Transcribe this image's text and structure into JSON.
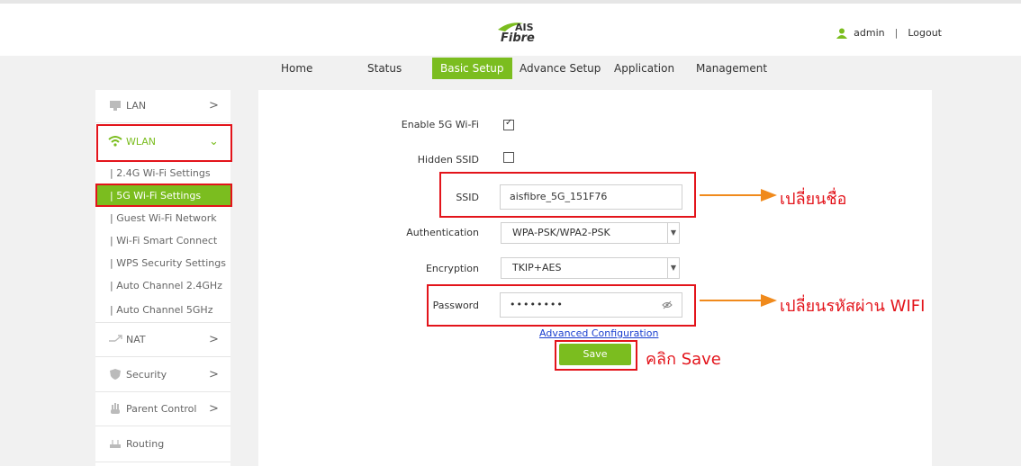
{
  "header": {
    "logo_top": "AIS",
    "logo_bottom": "Fibre",
    "user_name": "admin",
    "separator": "|",
    "logout_label": "Logout"
  },
  "nav": {
    "items": [
      {
        "label": "Home"
      },
      {
        "label": "Status"
      },
      {
        "label": "Basic Setup",
        "active": true
      },
      {
        "label": "Advance Setup"
      },
      {
        "label": "Application"
      },
      {
        "label": "Management"
      }
    ]
  },
  "sidebar": {
    "lan_label": "LAN",
    "wlan_label": "WLAN",
    "wlan_sub": [
      "| 2.4G Wi-Fi Settings",
      "| 5G Wi-Fi Settings",
      "| Guest Wi-Fi Network",
      "| Wi-Fi Smart Connect",
      "| WPS Security Settings",
      "| Auto Channel 2.4GHz",
      "| Auto Channel 5GHz"
    ],
    "nat_label": "NAT",
    "security_label": "Security",
    "parent_label": "Parent Control",
    "routing_label": "Routing"
  },
  "form": {
    "enable_label": "Enable 5G Wi-Fi",
    "enable_checked": true,
    "hidden_label": "Hidden SSID",
    "hidden_checked": false,
    "ssid_label": "SSID",
    "ssid_value": "aisfibre_5G_151F76",
    "auth_label": "Authentication",
    "auth_value": "WPA-PSK/WPA2-PSK",
    "enc_label": "Encryption",
    "enc_value": "TKIP+AES",
    "pwd_label": "Password",
    "pwd_value": "••••••••",
    "advanced_link": "Advanced Configuration",
    "save_label": "Save"
  },
  "annotations": {
    "ssid_note": "เปลี่ยนชื่อ",
    "pwd_note": "เปลี่ยนรหัสผ่าน WIFI",
    "save_note": "คลิก Save",
    "color": "#e3141b"
  },
  "colors": {
    "accent": "#7bbd1f",
    "link": "#1a3fcf"
  }
}
